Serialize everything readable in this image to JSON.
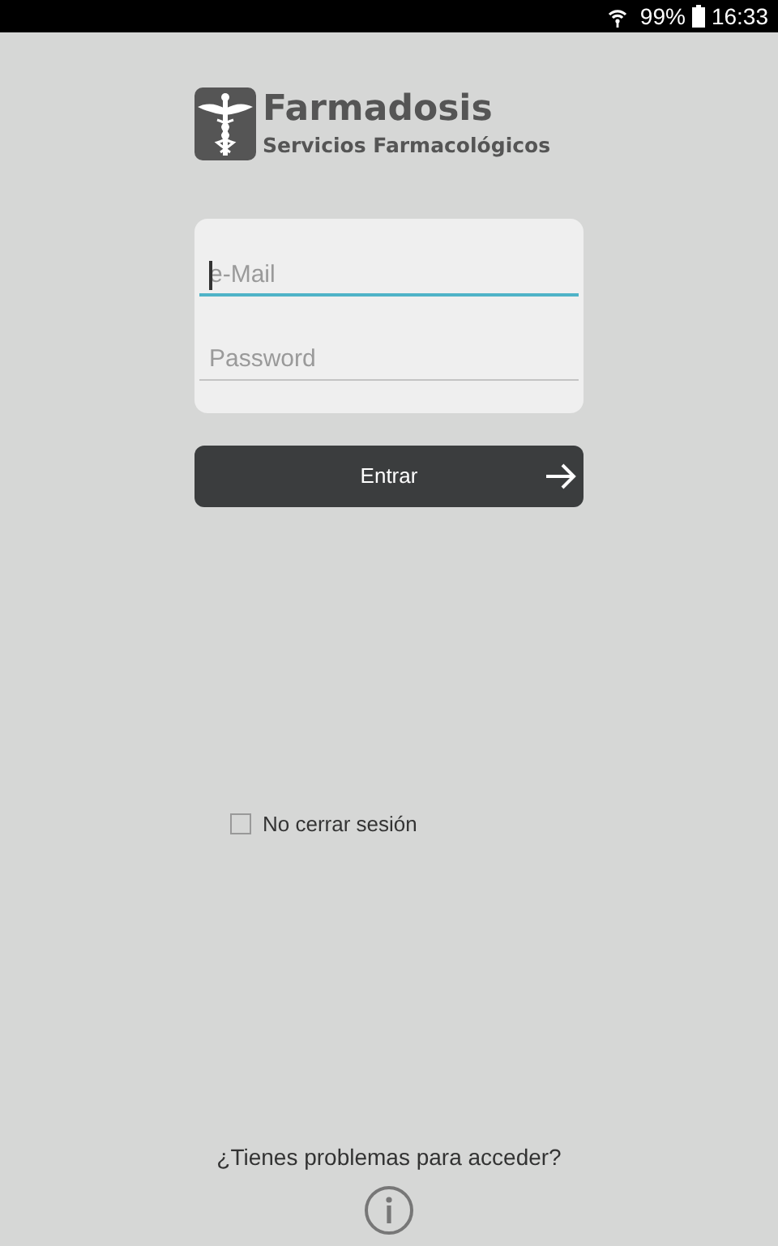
{
  "status_bar": {
    "battery": "99%",
    "time": "16:33"
  },
  "logo": {
    "title": "Farmadosis",
    "subtitle": "Servicios Farmacológicos"
  },
  "fields": [
    {
      "placeholder": "e-Mail",
      "focused": true
    },
    {
      "placeholder": "Password",
      "focused": false
    }
  ],
  "login_button": {
    "label": "Entrar"
  },
  "remember": {
    "label": "No cerrar sesión",
    "checked": false
  },
  "help": {
    "text": "¿Tienes problemas para acceder?"
  }
}
